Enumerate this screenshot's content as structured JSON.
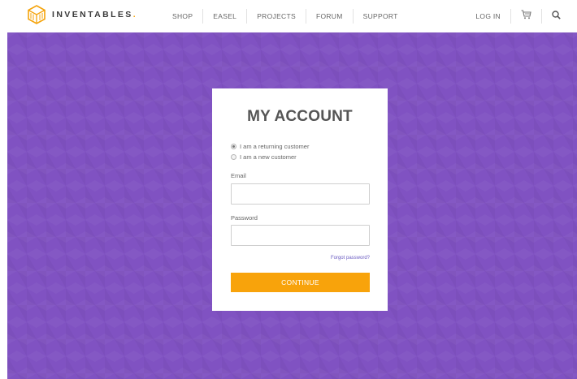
{
  "brand": {
    "name": "INVENTABLES",
    "dot": ".",
    "accent_color": "#f5a30a"
  },
  "nav": {
    "items": [
      {
        "id": "shop",
        "label": "SHOP"
      },
      {
        "id": "easel",
        "label": "EASEL"
      },
      {
        "id": "projects",
        "label": "PROJECTS"
      },
      {
        "id": "forum",
        "label": "FORUM"
      },
      {
        "id": "support",
        "label": "SUPPORT"
      }
    ],
    "login_label": "LOG IN",
    "cart_icon": "cart-icon",
    "search_icon": "search-icon"
  },
  "hero": {
    "background_color": "#8052c2"
  },
  "account": {
    "title": "MY ACCOUNT",
    "options": {
      "returning": {
        "label": "I am a returning customer",
        "selected": true
      },
      "new": {
        "label": "I am a new customer",
        "selected": false
      }
    },
    "email": {
      "label": "Email",
      "value": "",
      "placeholder": ""
    },
    "password": {
      "label": "Password",
      "value": "",
      "placeholder": ""
    },
    "forgot_label": "Forgot password?",
    "continue_label": "CONTINUE",
    "continue_color": "#f8a30b"
  }
}
